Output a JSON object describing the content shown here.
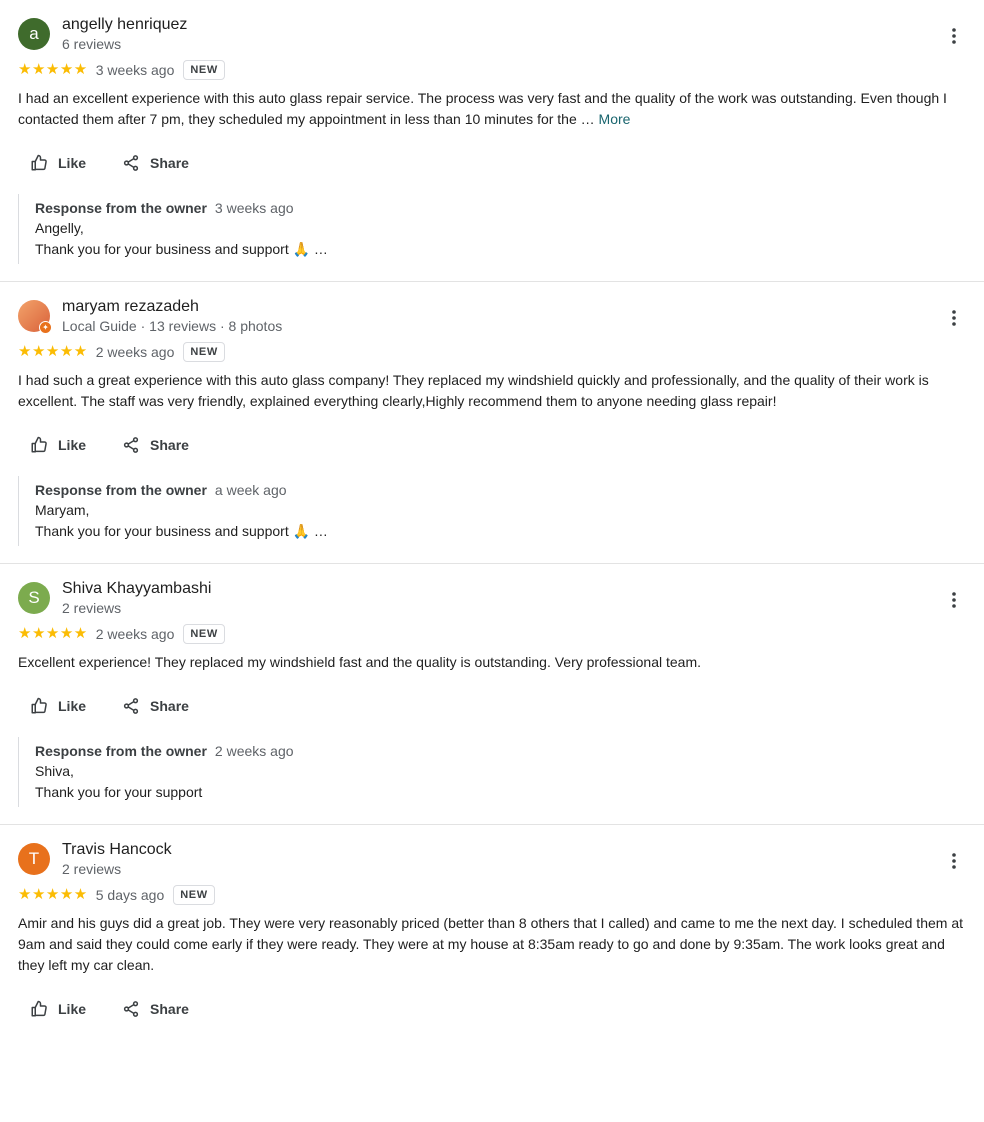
{
  "labels": {
    "like": "Like",
    "share": "Share",
    "owner_response": "Response from the owner",
    "new": "NEW",
    "stars": "★★★★★"
  },
  "reviews": [
    {
      "avatar_letter": "a",
      "avatar_color": "#3f6b2c",
      "name": "angelly henriquez",
      "meta": "6 reviews",
      "date": "3 weeks ago",
      "text": "I had an excellent experience with this auto glass repair service. The process was very fast and the quality of the work was outstanding. Even though I contacted them after 7 pm, they scheduled my appointment in less than 10 minutes for the … ",
      "more": "More",
      "owner_date": "3 weeks ago",
      "owner_line1": "Angelly,",
      "owner_line2": "Thank you for your business and support 🙏 …"
    },
    {
      "avatar_letter": "",
      "avatar_color": "#e0794a",
      "name": "maryam rezazadeh",
      "meta": "Local Guide · 13 reviews · 8 photos",
      "date": "2 weeks ago",
      "text": "I had such a great experience with this auto glass company! They replaced my windshield quickly and professionally, and the quality of their work is excellent. The staff was very friendly, explained everything clearly,Highly recommend them to anyone needing glass repair!",
      "more": "",
      "owner_date": "a week ago",
      "owner_line1": "Maryam,",
      "owner_line2": "Thank you for your business and support 🙏 …"
    },
    {
      "avatar_letter": "S",
      "avatar_color": "#7cab4e",
      "name": "Shiva Khayyambashi",
      "meta": "2 reviews",
      "date": "2 weeks ago",
      "text": "Excellent experience! They replaced my windshield fast and the quality is outstanding. Very professional team.",
      "more": "",
      "owner_date": "2 weeks ago",
      "owner_line1": "Shiva,",
      "owner_line2": "Thank you for your support"
    },
    {
      "avatar_letter": "T",
      "avatar_color": "#e8711c",
      "name": "Travis Hancock",
      "meta": "2 reviews",
      "date": "5 days ago",
      "text": "Amir and his guys did a great job. They were very reasonably priced (better than 8 others that I called) and came to me the next day. I scheduled them at 9am and said they could come early if they were ready. They were at my house at 8:35am ready to go and done by 9:35am. The work looks great and they left my car clean.",
      "more": ""
    }
  ]
}
